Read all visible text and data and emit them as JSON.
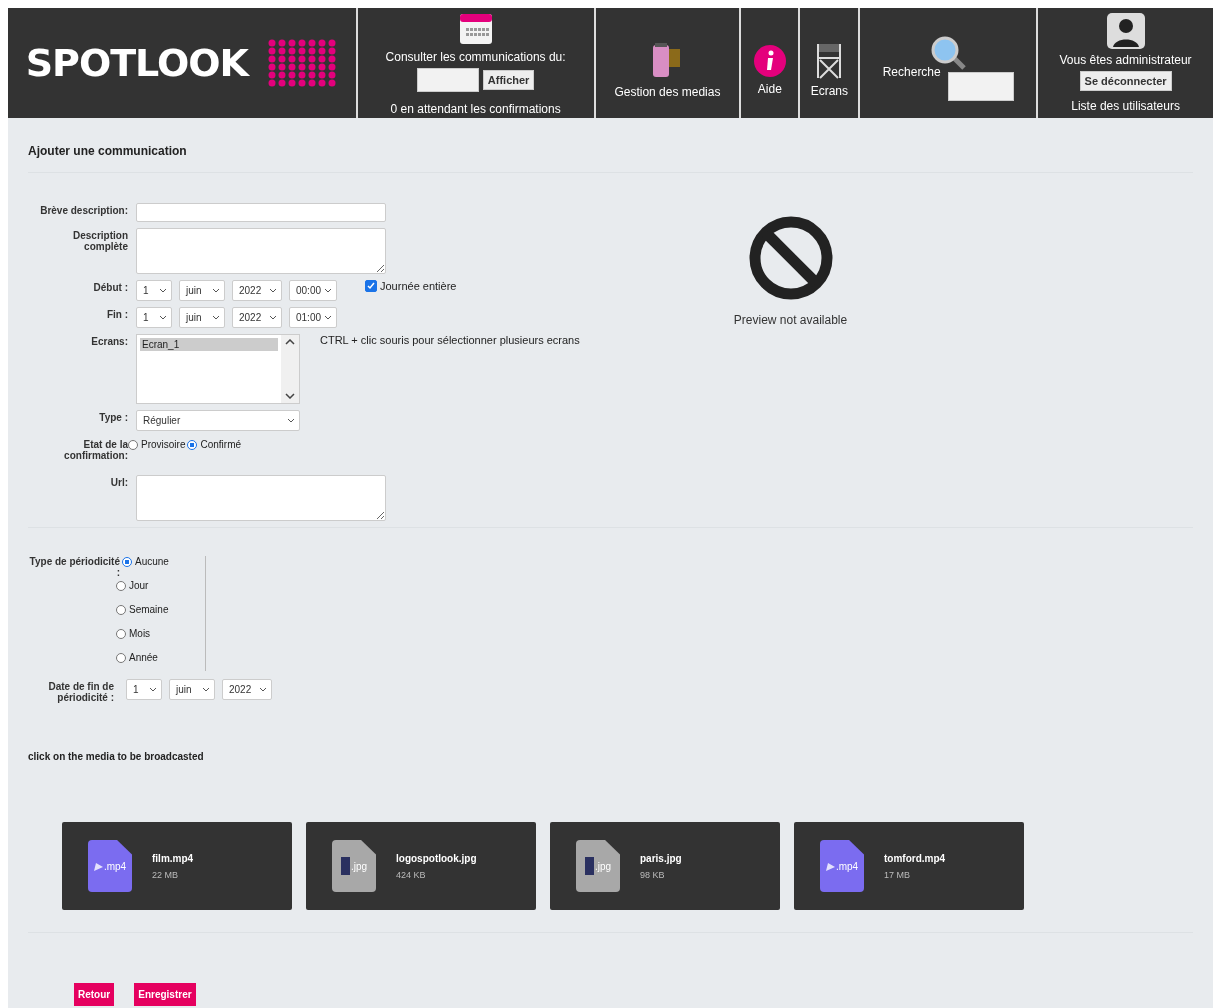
{
  "header": {
    "logo": "SPOTLOOK",
    "consult": {
      "label": "Consulter les communications du:",
      "button": "Afficher",
      "pending": "0 en attendant les confirmations"
    },
    "nav": [
      {
        "kind": "media",
        "label": "Gestion des medias"
      },
      {
        "kind": "help",
        "label": "Aide"
      },
      {
        "kind": "screens",
        "label": "Ecrans"
      }
    ],
    "search": {
      "label": "Recherche"
    },
    "user": {
      "status": "Vous êtes administrateur",
      "logout": "Se déconnecter",
      "users_link": "Liste des utilisateurs"
    }
  },
  "form": {
    "title": "Ajouter une communication",
    "short_label": "Brève description:",
    "full_label": "Description complète",
    "start": {
      "label": "Début :",
      "values": [
        "1",
        "juin",
        "2022",
        "00:00"
      ]
    },
    "end": {
      "label": "Fin :",
      "values": [
        "1",
        "juin",
        "2022",
        "01:00"
      ]
    },
    "all_day": {
      "label": "Journée entière",
      "checked": true
    },
    "screens": {
      "label": "Ecrans:",
      "items": [
        {
          "label": "Ecran_1",
          "selected": true
        }
      ],
      "hint": "CTRL + clic souris pour sélectionner plusieurs ecrans"
    },
    "type": {
      "label": "Type :",
      "value": "Régulier"
    },
    "state": {
      "label": "Etat de la confirmation:",
      "options": [
        {
          "label": "Provisoire",
          "selected": false
        },
        {
          "label": "Confirmé",
          "selected": true
        }
      ]
    },
    "url_label": "Url:",
    "preview": "Preview not available"
  },
  "periodicity": {
    "label": "Type de périodicité :",
    "options": [
      {
        "label": "Aucune",
        "selected": true
      },
      {
        "label": "Jour",
        "selected": false
      },
      {
        "label": "Semaine",
        "selected": false
      },
      {
        "label": "Mois",
        "selected": false
      },
      {
        "label": "Année",
        "selected": false
      }
    ],
    "end": {
      "label": "Date de fin de périodicité :",
      "values": [
        "1",
        "juin",
        "2022"
      ]
    }
  },
  "media": {
    "hint": "click on the media to be broadcasted",
    "files": [
      {
        "kind": "video",
        "ext": ".mp4",
        "name": "film.mp4",
        "size": "22 MB"
      },
      {
        "kind": "image",
        "ext": ".jpg",
        "name": "logospotlook.jpg",
        "size": "424 KB"
      },
      {
        "kind": "image",
        "ext": ".jpg",
        "name": "paris.jpg",
        "size": "98 KB"
      },
      {
        "kind": "video",
        "ext": ".mp4",
        "name": "tomford.mp4",
        "size": "17 MB"
      }
    ]
  },
  "buttons": [
    "Retour",
    "Enregistrer"
  ]
}
